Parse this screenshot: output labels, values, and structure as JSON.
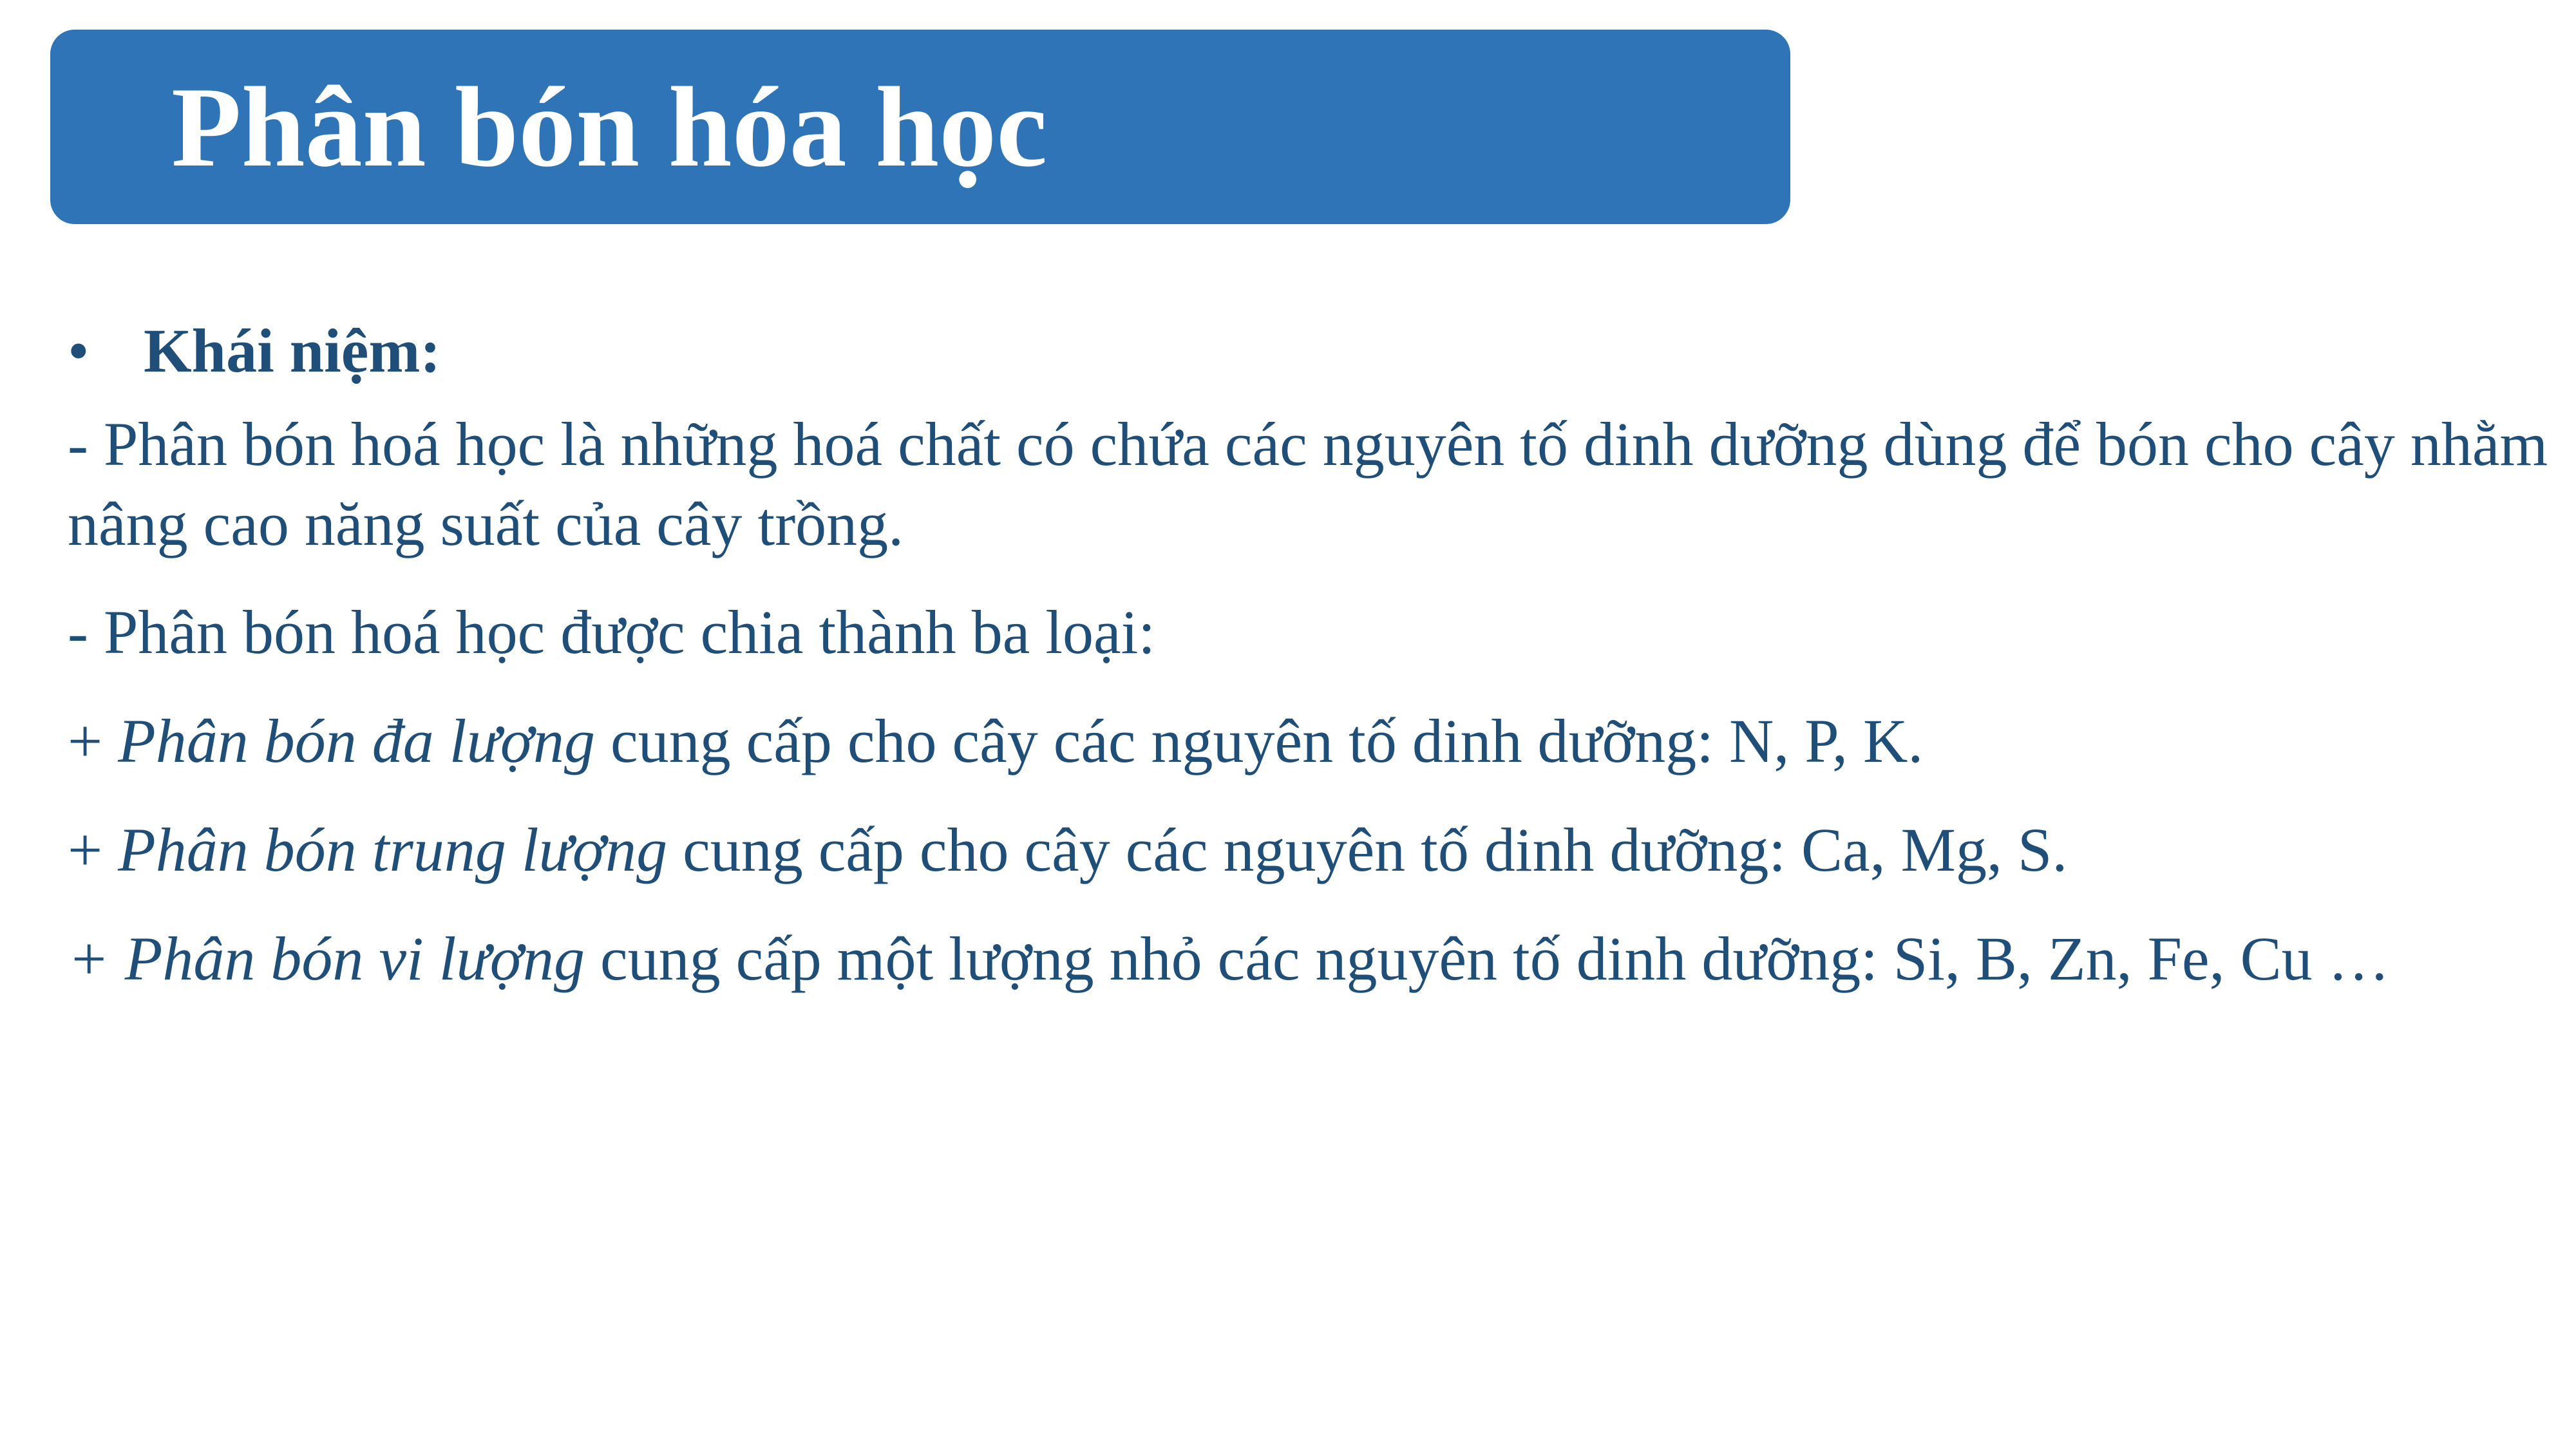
{
  "title": "Phân bón hóa học",
  "bullet": {
    "marker": "•",
    "label": "Khái niệm:"
  },
  "paragraphs": {
    "definition": "- Phân bón hoá học là những hoá chất có chứa các nguyên tố dinh dưỡng dùng để bón cho cây nhằm nâng cao năng suất của cây trồng.",
    "classification": "- Phân bón hoá học được chia thành ba loại:",
    "macro": {
      "prefix": "+ ",
      "term": "Phân bón đa lượng",
      "rest": " cung cấp cho cây các nguyên tố dinh dưỡng: N, P, K."
    },
    "secondary": {
      "prefix": "+ ",
      "term": "Phân bón trung lượng",
      "rest": " cung cấp cho cây các nguyên tố dinh dưỡng: Ca, Mg, S."
    },
    "micro": {
      "prefix": "+ Phân bón vi lượng",
      "rest": " cung cấp một lượng nhỏ các nguyên tố dinh dưỡng: Si, B, Zn, Fe, Cu …"
    }
  },
  "colors": {
    "title_bar": "#2E74B7",
    "title_text": "#FFFFFF",
    "body_text": "#1F4E79"
  }
}
